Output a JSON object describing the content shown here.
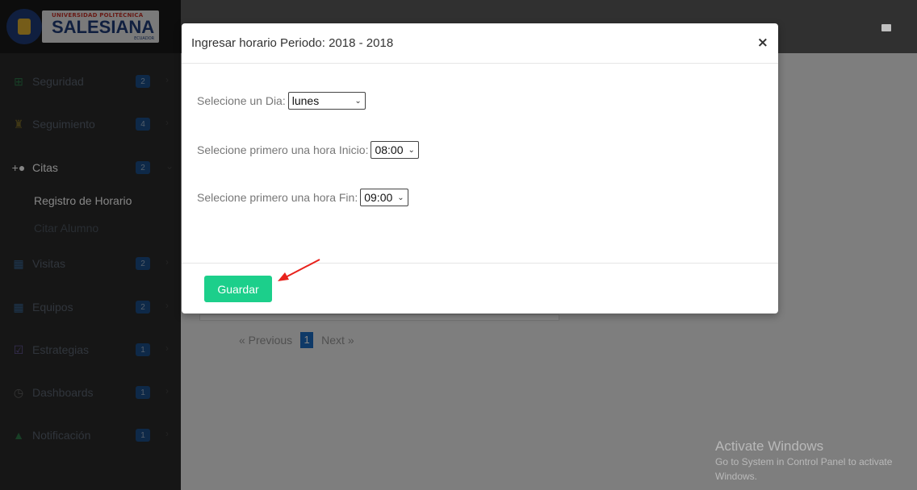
{
  "logo": {
    "top_text": "UNIVERSIDAD POLITÉCNICA",
    "name": "SALESIANA",
    "country": "ECUADOR"
  },
  "sidebar": {
    "items": [
      {
        "label": "Seguridad",
        "badge": "2",
        "icon": "table-icon"
      },
      {
        "label": "Seguimiento",
        "badge": "4",
        "icon": "binoculars-icon"
      },
      {
        "label": "Citas",
        "badge": "2",
        "icon": "user-plus-icon"
      },
      {
        "label": "Visitas",
        "badge": "2",
        "icon": "map-icon"
      },
      {
        "label": "Equipos",
        "badge": "2",
        "icon": "map-icon"
      },
      {
        "label": "Estrategias",
        "badge": "1",
        "icon": "check-square-icon"
      },
      {
        "label": "Dashboards",
        "badge": "1",
        "icon": "clock-icon"
      },
      {
        "label": "Notificación",
        "badge": "1",
        "icon": "bell-icon"
      }
    ],
    "subitems": [
      {
        "label": "Registro de Horario"
      },
      {
        "label": "Citar Alumno"
      }
    ]
  },
  "pager": {
    "previous": "« Previous",
    "page": "1",
    "next": "Next »"
  },
  "modal": {
    "title": "Ingresar horario Periodo: 2018 - 2018",
    "close": "×",
    "day_label": "Selecione un Dia:",
    "day_value": "lunes",
    "start_label": "Selecione primero una hora Inicio:",
    "start_value": "08:00",
    "end_label": "Selecione primero una hora Fin:",
    "end_value": "09:00",
    "save_label": "Guardar"
  },
  "watermark": {
    "title": "Activate Windows",
    "subtitle": "Go to System in Control Panel to activate Windows."
  },
  "colors": {
    "save_button": "#1ccf8b",
    "badge": "#1c4f8a",
    "annotation_arrow": "#e8221c"
  }
}
